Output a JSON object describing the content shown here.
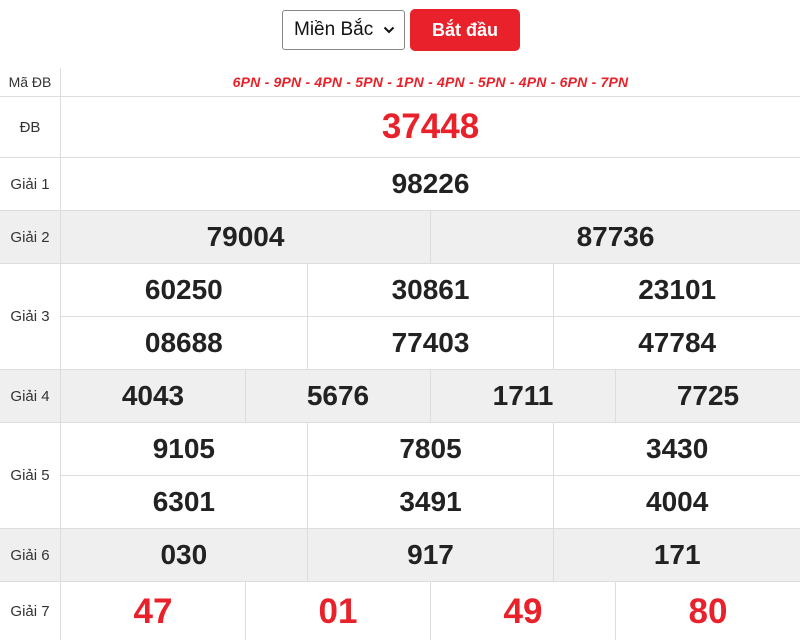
{
  "controls": {
    "region_selected": "Miền Bắc",
    "start_label": "Bắt đầu"
  },
  "labels": {
    "code": "Mã ĐB",
    "db": "ĐB",
    "g1": "Giải 1",
    "g2": "Giải 2",
    "g3": "Giải 3",
    "g4": "Giải 4",
    "g5": "Giải 5",
    "g6": "Giải 6",
    "g7": "Giải 7"
  },
  "special_code": "6PN - 9PN - 4PN - 5PN - 1PN - 4PN - 5PN - 4PN - 6PN - 7PN",
  "prizes": {
    "db": [
      "37448"
    ],
    "g1": [
      "98226"
    ],
    "g2": [
      "79004",
      "87736"
    ],
    "g3": [
      "60250",
      "30861",
      "23101",
      "08688",
      "77403",
      "47784"
    ],
    "g4": [
      "4043",
      "5676",
      "1711",
      "7725"
    ],
    "g5": [
      "9105",
      "7805",
      "3430",
      "6301",
      "3491",
      "4004"
    ],
    "g6": [
      "030",
      "917",
      "171"
    ],
    "g7": [
      "47",
      "01",
      "49",
      "80"
    ]
  },
  "colors": {
    "accent": "#e8212a",
    "row_grey": "#efefef",
    "border": "#dddddd"
  }
}
